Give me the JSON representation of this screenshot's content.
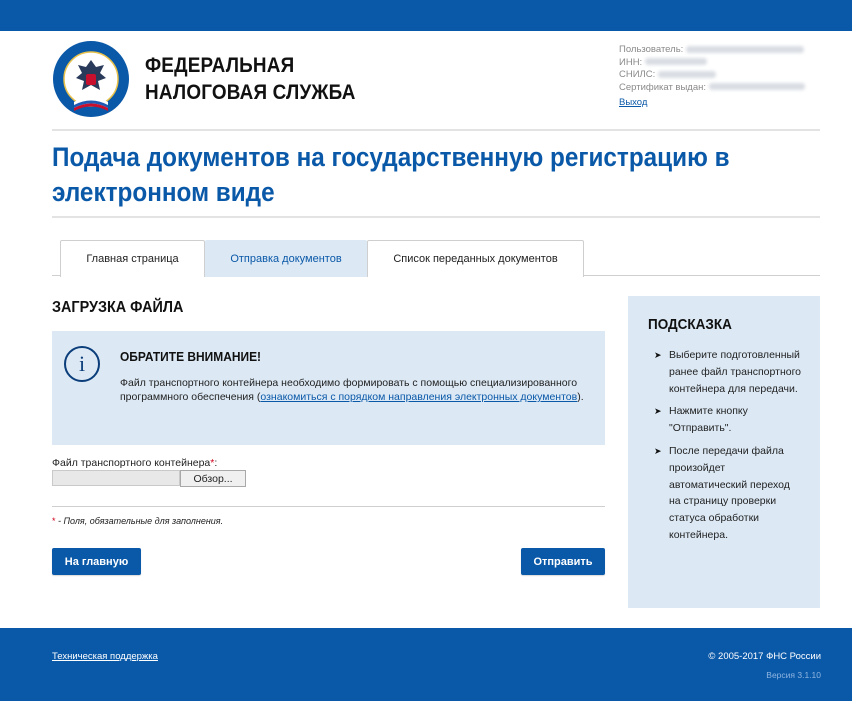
{
  "header": {
    "brand_line1": "ФЕДЕРАЛЬНАЯ",
    "brand_line2": "НАЛОГОВАЯ СЛУЖБА",
    "user_label": "Пользователь:",
    "inn_label": "ИНН:",
    "snils_label": "СНИЛС:",
    "cert_label": "Сертификат выдан:",
    "logout": "Выход"
  },
  "page_title": "Подача документов на государственную регистрацию в электронном виде",
  "tabs": [
    {
      "label": "Главная страница"
    },
    {
      "label": "Отправка документов"
    },
    {
      "label": "Список переданных документов"
    }
  ],
  "main": {
    "section_title": "ЗАГРУЗКА ФАЙЛА",
    "notice": {
      "title": "ОБРАТИТЕ ВНИМАНИЕ!",
      "text_before": "Файл транспортного контейнера необходимо формировать с помощью специализированного программного обеспечения (",
      "link": "ознакомиться с порядком направления электронных документов",
      "text_after": ")."
    },
    "field_label": "Файл транспортного контейнера",
    "required_mark": "*",
    "required_colon": ":",
    "browse_button": "Обзор...",
    "required_note": " - Поля, обязательные для заполнения.",
    "home_button": "На главную",
    "submit_button": "Отправить"
  },
  "hint": {
    "title": "ПОДСКАЗКА",
    "items": [
      "Выберите подготовленный ранее файл транспортного контейнера для передачи.",
      "Нажмите кнопку \"Отправить\".",
      "После передачи файла произойдет автоматический переход на страницу проверки статуса обработки контейнера."
    ]
  },
  "footer": {
    "support_link": "Техническая поддержка",
    "copyright": "© 2005-2017 ФНС России",
    "version": "Версия 3.1.10"
  },
  "colors": {
    "brand_blue": "#0a58a8",
    "panel_blue": "#dce9f5",
    "required_red": "#d0021b"
  }
}
